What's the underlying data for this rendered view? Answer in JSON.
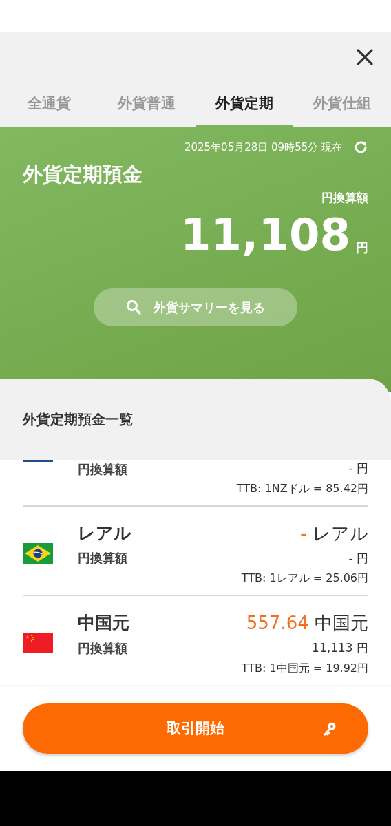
{
  "tabs": [
    {
      "label": "全通貨",
      "selected": false
    },
    {
      "label": "外貨普通",
      "selected": false
    },
    {
      "label": "外貨定期",
      "selected": true
    },
    {
      "label": "外貨仕組",
      "selected": false
    }
  ],
  "summary": {
    "timestamp": "2025年05月28日 09時55分 現在",
    "title": "外貨定期預金",
    "total_label": "円換算額",
    "total_value": "11,108",
    "total_unit": "円",
    "summary_button": "外貨サマリーを見る"
  },
  "list": {
    "title": "外貨定期預金一覧",
    "rows": [
      {
        "kind": "partial",
        "flag": {
          "kind": "nz"
        },
        "conversion_label": "円換算額",
        "yen": "- 円",
        "rate": "TTB: 1NZドル = 85.42円"
      },
      {
        "kind": "full",
        "flag": {
          "kind": "br"
        },
        "name": "レアル",
        "amount": "-",
        "amount_unit": "レアル",
        "conversion_label": "円換算額",
        "yen": "- 円",
        "rate": "TTB: 1レアル = 25.06円"
      },
      {
        "kind": "full",
        "flag": {
          "kind": "cn"
        },
        "name": "中国元",
        "amount": "557.64",
        "amount_unit": "中国元",
        "conversion_label": "円換算額",
        "yen": "11,113 円",
        "rate": "TTB: 1中国元 = 19.92円"
      }
    ]
  },
  "action_button": "取引開始"
}
